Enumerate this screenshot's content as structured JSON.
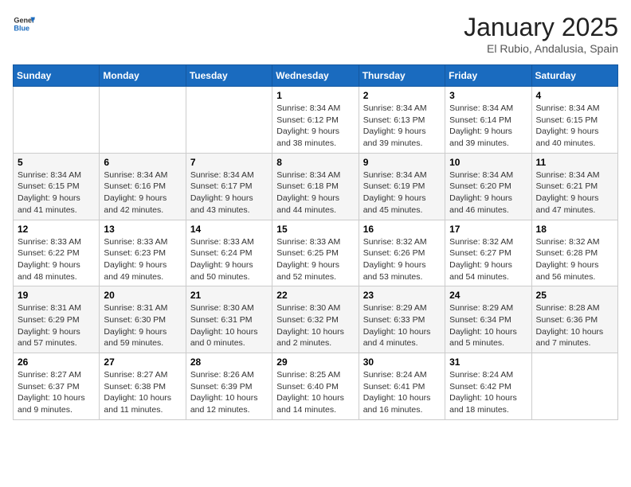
{
  "header": {
    "logo_general": "General",
    "logo_blue": "Blue",
    "title": "January 2025",
    "location": "El Rubio, Andalusia, Spain"
  },
  "weekdays": [
    "Sunday",
    "Monday",
    "Tuesday",
    "Wednesday",
    "Thursday",
    "Friday",
    "Saturday"
  ],
  "weeks": [
    [
      {
        "day": "",
        "info": ""
      },
      {
        "day": "",
        "info": ""
      },
      {
        "day": "",
        "info": ""
      },
      {
        "day": "1",
        "info": "Sunrise: 8:34 AM\nSunset: 6:12 PM\nDaylight: 9 hours and 38 minutes."
      },
      {
        "day": "2",
        "info": "Sunrise: 8:34 AM\nSunset: 6:13 PM\nDaylight: 9 hours and 39 minutes."
      },
      {
        "day": "3",
        "info": "Sunrise: 8:34 AM\nSunset: 6:14 PM\nDaylight: 9 hours and 39 minutes."
      },
      {
        "day": "4",
        "info": "Sunrise: 8:34 AM\nSunset: 6:15 PM\nDaylight: 9 hours and 40 minutes."
      }
    ],
    [
      {
        "day": "5",
        "info": "Sunrise: 8:34 AM\nSunset: 6:15 PM\nDaylight: 9 hours and 41 minutes."
      },
      {
        "day": "6",
        "info": "Sunrise: 8:34 AM\nSunset: 6:16 PM\nDaylight: 9 hours and 42 minutes."
      },
      {
        "day": "7",
        "info": "Sunrise: 8:34 AM\nSunset: 6:17 PM\nDaylight: 9 hours and 43 minutes."
      },
      {
        "day": "8",
        "info": "Sunrise: 8:34 AM\nSunset: 6:18 PM\nDaylight: 9 hours and 44 minutes."
      },
      {
        "day": "9",
        "info": "Sunrise: 8:34 AM\nSunset: 6:19 PM\nDaylight: 9 hours and 45 minutes."
      },
      {
        "day": "10",
        "info": "Sunrise: 8:34 AM\nSunset: 6:20 PM\nDaylight: 9 hours and 46 minutes."
      },
      {
        "day": "11",
        "info": "Sunrise: 8:34 AM\nSunset: 6:21 PM\nDaylight: 9 hours and 47 minutes."
      }
    ],
    [
      {
        "day": "12",
        "info": "Sunrise: 8:33 AM\nSunset: 6:22 PM\nDaylight: 9 hours and 48 minutes."
      },
      {
        "day": "13",
        "info": "Sunrise: 8:33 AM\nSunset: 6:23 PM\nDaylight: 9 hours and 49 minutes."
      },
      {
        "day": "14",
        "info": "Sunrise: 8:33 AM\nSunset: 6:24 PM\nDaylight: 9 hours and 50 minutes."
      },
      {
        "day": "15",
        "info": "Sunrise: 8:33 AM\nSunset: 6:25 PM\nDaylight: 9 hours and 52 minutes."
      },
      {
        "day": "16",
        "info": "Sunrise: 8:32 AM\nSunset: 6:26 PM\nDaylight: 9 hours and 53 minutes."
      },
      {
        "day": "17",
        "info": "Sunrise: 8:32 AM\nSunset: 6:27 PM\nDaylight: 9 hours and 54 minutes."
      },
      {
        "day": "18",
        "info": "Sunrise: 8:32 AM\nSunset: 6:28 PM\nDaylight: 9 hours and 56 minutes."
      }
    ],
    [
      {
        "day": "19",
        "info": "Sunrise: 8:31 AM\nSunset: 6:29 PM\nDaylight: 9 hours and 57 minutes."
      },
      {
        "day": "20",
        "info": "Sunrise: 8:31 AM\nSunset: 6:30 PM\nDaylight: 9 hours and 59 minutes."
      },
      {
        "day": "21",
        "info": "Sunrise: 8:30 AM\nSunset: 6:31 PM\nDaylight: 10 hours and 0 minutes."
      },
      {
        "day": "22",
        "info": "Sunrise: 8:30 AM\nSunset: 6:32 PM\nDaylight: 10 hours and 2 minutes."
      },
      {
        "day": "23",
        "info": "Sunrise: 8:29 AM\nSunset: 6:33 PM\nDaylight: 10 hours and 4 minutes."
      },
      {
        "day": "24",
        "info": "Sunrise: 8:29 AM\nSunset: 6:34 PM\nDaylight: 10 hours and 5 minutes."
      },
      {
        "day": "25",
        "info": "Sunrise: 8:28 AM\nSunset: 6:36 PM\nDaylight: 10 hours and 7 minutes."
      }
    ],
    [
      {
        "day": "26",
        "info": "Sunrise: 8:27 AM\nSunset: 6:37 PM\nDaylight: 10 hours and 9 minutes."
      },
      {
        "day": "27",
        "info": "Sunrise: 8:27 AM\nSunset: 6:38 PM\nDaylight: 10 hours and 11 minutes."
      },
      {
        "day": "28",
        "info": "Sunrise: 8:26 AM\nSunset: 6:39 PM\nDaylight: 10 hours and 12 minutes."
      },
      {
        "day": "29",
        "info": "Sunrise: 8:25 AM\nSunset: 6:40 PM\nDaylight: 10 hours and 14 minutes."
      },
      {
        "day": "30",
        "info": "Sunrise: 8:24 AM\nSunset: 6:41 PM\nDaylight: 10 hours and 16 minutes."
      },
      {
        "day": "31",
        "info": "Sunrise: 8:24 AM\nSunset: 6:42 PM\nDaylight: 10 hours and 18 minutes."
      },
      {
        "day": "",
        "info": ""
      }
    ]
  ]
}
